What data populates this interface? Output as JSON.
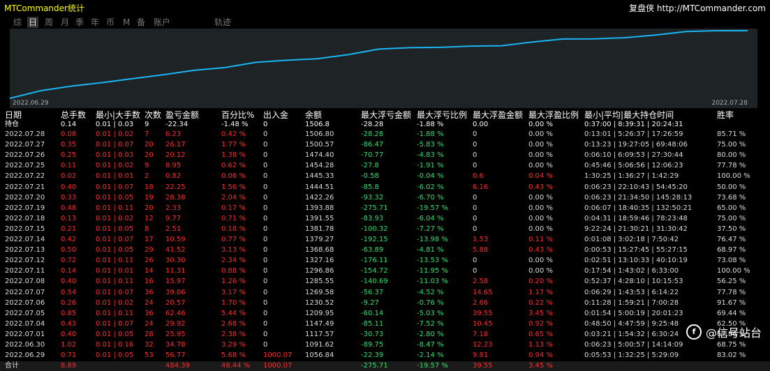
{
  "app_title": "MTCommander统计",
  "brand": "复盘侠 http://MTCommander.com",
  "tabs": [
    "综",
    "日",
    "周",
    "月",
    "季",
    "年",
    "币",
    "M",
    "备",
    "账户",
    "轨迹"
  ],
  "active_tab": "日",
  "chart": {
    "start_label": "2022.06.29",
    "end_label": "2022.07.28",
    "line_color": "#19b5f5",
    "balance_series": [
      1000.07,
      1056.84,
      1091.62,
      1117.57,
      1147.49,
      1177.41,
      1209.95,
      1230.52,
      1269.58,
      1285.55,
      1296.86,
      1327.16,
      1368.68,
      1379.27,
      1381.78,
      1391.55,
      1393.88,
      1422.26,
      1444.51,
      1445.33,
      1454.28,
      1474.4,
      1500.57,
      1506.8,
      1506.8
    ]
  },
  "headers": [
    "日期",
    "总手数",
    "最小|大手数",
    "次数",
    "盈亏金额",
    "百分比%",
    "出入金",
    "余额",
    "最大浮亏金额",
    "最大浮亏比例",
    "最大浮盈金额",
    "最大浮盈比例",
    "最小|平均|最大持仓时间",
    "胜率"
  ],
  "holding": [
    "持仓",
    "0.14",
    "0.01 | 0.03",
    "9",
    "-22.34",
    "-1.48 %",
    "0",
    "1506.8",
    "-28.28",
    "-1.88 %",
    "0.00",
    "0.00 %",
    "0:37:00 | 8:39:31 | 20:24:31",
    ""
  ],
  "rows": [
    [
      "2022.07.28",
      "0.08",
      "0.01 | 0.02",
      "7",
      "6.23",
      "0.42 %",
      "0",
      "1506.80",
      "-28.28",
      "-1.88 %",
      "0",
      "0.00 %",
      "0:13:01 | 5:26:37 | 17:26:59",
      "85.71 %"
    ],
    [
      "2022.07.27",
      "0.35",
      "0.01 | 0.07",
      "20",
      "26.17",
      "1.77 %",
      "0",
      "1500.57",
      "-86.47",
      "-5.83 %",
      "0",
      "0.00 %",
      "0:13:23 | 19:27:05 | 69:48:06",
      "75.00 %"
    ],
    [
      "2022.07.26",
      "0.25",
      "0.01 | 0.03",
      "20",
      "20.12",
      "1.38 %",
      "0",
      "1474.40",
      "-70.77",
      "-4.83 %",
      "0",
      "0.00 %",
      "0:06:10 | 6:09:53 | 27:30:44",
      "80.00 %"
    ],
    [
      "2022.07.25",
      "0.11",
      "0.01 | 0.02",
      "9",
      "8.95",
      "0.62 %",
      "0",
      "1454.28",
      "-27.8",
      "-1.91 %",
      "0",
      "0.00 %",
      "0:45:46 | 5:06:56 | 12:06:23",
      "77.78 %"
    ],
    [
      "2022.07.22",
      "0.02",
      "0.01 | 0.01",
      "2",
      "0.82",
      "0.06 %",
      "0",
      "1445.33",
      "-0.58",
      "-0.04 %",
      "0.6",
      "0.04 %",
      "1:30:25 | 1:36:27 | 1:42:29",
      "100.00 %"
    ],
    [
      "2022.07.21",
      "0.40",
      "0.01 | 0.07",
      "18",
      "22.25",
      "1.56 %",
      "0",
      "1444.51",
      "-85.8",
      "-6.02 %",
      "6.16",
      "0.43 %",
      "0:06:23 | 22:10:43 | 54:45:20",
      "50.00 %"
    ],
    [
      "2022.07.20",
      "0.33",
      "0.01 | 0.05",
      "19",
      "28.38",
      "2.04 %",
      "0",
      "1422.26",
      "-93.32",
      "-6.70 %",
      "0",
      "0.00 %",
      "0:06:23 | 21:34:50 | 145:28:13",
      "73.68 %"
    ],
    [
      "2022.07.19",
      "0.48",
      "0.01 | 0.11",
      "20",
      "2.33",
      "0.17 %",
      "0",
      "1393.88",
      "-275.71",
      "-19.57 %",
      "0",
      "0.00 %",
      "0:06:07 | 18:40:35 | 132:50:21",
      "65.00 %"
    ],
    [
      "2022.07.18",
      "0.13",
      "0.01 | 0.02",
      "12",
      "9.77",
      "0.71 %",
      "0",
      "1391.55",
      "-83.93",
      "-6.04 %",
      "0",
      "0.00 %",
      "0:04:31 | 18:59:46 | 78:23:48",
      "75.00 %"
    ],
    [
      "2022.07.15",
      "0.21",
      "0.01 | 0.05",
      "8",
      "2.51",
      "0.18 %",
      "0",
      "1381.78",
      "-100.32",
      "-7.27 %",
      "0",
      "0.00 %",
      "9:22:24 | 21:30:21 | 31:30:42",
      "37.50 %"
    ],
    [
      "2022.07.14",
      "0.42",
      "0.01 | 0.07",
      "17",
      "10.59",
      "0.77 %",
      "0",
      "1379.27",
      "-192.15",
      "-13.98 %",
      "1.53",
      "0.11 %",
      "0:01:08 | 3:02:18 | 7:50:42",
      "76.47 %"
    ],
    [
      "2022.07.13",
      "0.50",
      "0.01 | 0.05",
      "29",
      "41.52",
      "3.13 %",
      "0",
      "1368.68",
      "-63.89",
      "-4.81 %",
      "5.88",
      "0.43 %",
      "0:00:53 | 15:27:45 | 55:27:15",
      "68.97 %"
    ],
    [
      "2022.07.12",
      "0.72",
      "0.01 | 0.11",
      "26",
      "30.30",
      "2.34 %",
      "0",
      "1327.16",
      "-176.11",
      "-13.53 %",
      "0",
      "0.00 %",
      "0:02:51 | 13:10:33 | 40:10:19",
      "73.08 %"
    ],
    [
      "2022.07.11",
      "0.14",
      "0.01 | 0.01",
      "14",
      "11.31",
      "0.88 %",
      "0",
      "1296.86",
      "-154.72",
      "-11.95 %",
      "0",
      "0.00 %",
      "0:17:54 | 1:43:02 | 6:33:00",
      "100.00 %"
    ],
    [
      "2022.07.08",
      "0.40",
      "0.01 | 0.11",
      "16",
      "15.97",
      "1.26 %",
      "0",
      "1285.55",
      "-140.69",
      "-11.03 %",
      "2.58",
      "0.20 %",
      "0:52:37 | 4:28:10 | 10:15:53",
      "56.25 %"
    ],
    [
      "2022.07.07",
      "0.54",
      "0.01 | 0.07",
      "36",
      "39.06",
      "3.17 %",
      "0",
      "1269.58",
      "-56.37",
      "-4.52 %",
      "14.65",
      "1.17 %",
      "0:06:29 | 1:43:53 | 6:14:22",
      "77.78 %"
    ],
    [
      "2022.07.06",
      "0.26",
      "0.01 | 0.02",
      "24",
      "20.57",
      "1.70 %",
      "0",
      "1230.52",
      "-9.27",
      "-0.76 %",
      "2.66",
      "0.22 %",
      "0:11:28 | 1:59:21 | 7:00:28",
      "91.67 %"
    ],
    [
      "2022.07.05",
      "0.85",
      "0.01 | 0.11",
      "36",
      "62.46",
      "5.44 %",
      "0",
      "1209.95",
      "-60.14",
      "-5.03 %",
      "39.55",
      "3.45 %",
      "0:01:54 | 5:00:19 | 20:01:23",
      "69.44 %"
    ],
    [
      "2022.07.04",
      "0.43",
      "0.01 | 0.07",
      "24",
      "29.92",
      "2.68 %",
      "0",
      "1147.49",
      "-85.11",
      "-7.52 %",
      "10.45",
      "0.92 %",
      "0:48:50 | 4:47:59 | 9:25:48",
      "62.50 %"
    ],
    [
      "2022.07.01",
      "0.40",
      "0.01 | 0.05",
      "28",
      "25.95",
      "2.38 %",
      "0",
      "1117.57",
      "-30.73",
      "-2.80 %",
      "7.18",
      "0.65 %",
      "0:03:21 | 1:54:32 | 6:30:24",
      "67.86 %"
    ],
    [
      "2022.06.30",
      "1.02",
      "0.01 | 0.16",
      "32",
      "34.78",
      "3.29 %",
      "0",
      "1091.62",
      "-89.75",
      "-8.47 %",
      "12.23",
      "1.13 %",
      "0:06:23 | 5:00:57 | 14:14:09",
      "68.75 %"
    ],
    [
      "2022.06.29",
      "0.71",
      "0.01 | 0.05",
      "53",
      "56.77",
      "5.68 %",
      "1000.07",
      "1056.84",
      "-22.39",
      "-2.14 %",
      "9.81",
      "0.94 %",
      "0:05:53 | 1:32:25 | 5:29:09",
      "83.02 %"
    ]
  ],
  "total": [
    "合计",
    "8.89",
    "",
    "",
    "484.39",
    "48.44 %",
    "1000.07",
    "",
    "-275.71",
    "-19.57 %",
    "39.55",
    "3.45 %",
    "",
    ""
  ],
  "watermark": "@信号站台"
}
